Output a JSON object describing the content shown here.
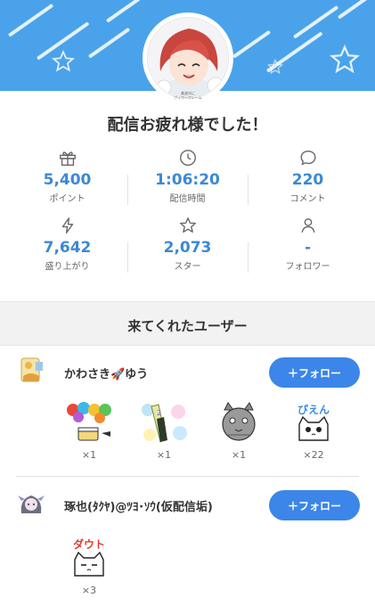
{
  "header": {
    "avatar_caption": "美波ゆに",
    "avatar_subcaption": "ヴィワーフレーム"
  },
  "title": "配信お疲れ様でした！",
  "stats": [
    {
      "icon": "gift-icon",
      "value": "5,400",
      "label": "ポイント"
    },
    {
      "icon": "clock-icon",
      "value": "1:06:20",
      "label": "配信時間"
    },
    {
      "icon": "comment-icon",
      "value": "220",
      "label": "コメント"
    },
    {
      "icon": "lightning-icon",
      "value": "7,642",
      "label": "盛り上がり"
    },
    {
      "icon": "star-outline-icon",
      "value": "2,073",
      "label": "スター"
    },
    {
      "icon": "person-icon",
      "value": "-",
      "label": "フォロワー"
    }
  ],
  "section_title": "来てくれたユーザー",
  "users": [
    {
      "name": "かわさき🚀ゆう",
      "follow_label": "＋フォロー",
      "gifts": [
        {
          "icon": "balloons-cake-gift-icon",
          "count": "×1"
        },
        {
          "icon": "champagne-gift-icon",
          "count": "×1"
        },
        {
          "icon": "robot-cat-gift-icon",
          "count": "×1"
        },
        {
          "icon": "pien-cat-gift-icon",
          "count": "×22",
          "text": "ぴえん"
        }
      ]
    },
    {
      "name": "琢也(ﾀｸﾔ)@ﾂﾖ･ｿｳ(仮配信垢)",
      "follow_label": "＋フォロー",
      "gifts": [
        {
          "icon": "dout-cat-gift-icon",
          "count": "×3",
          "text": "ダウト"
        }
      ]
    }
  ],
  "colors": {
    "banner": "#4aa3ea",
    "accent": "#3c88d6",
    "button": "#3b86e8"
  }
}
